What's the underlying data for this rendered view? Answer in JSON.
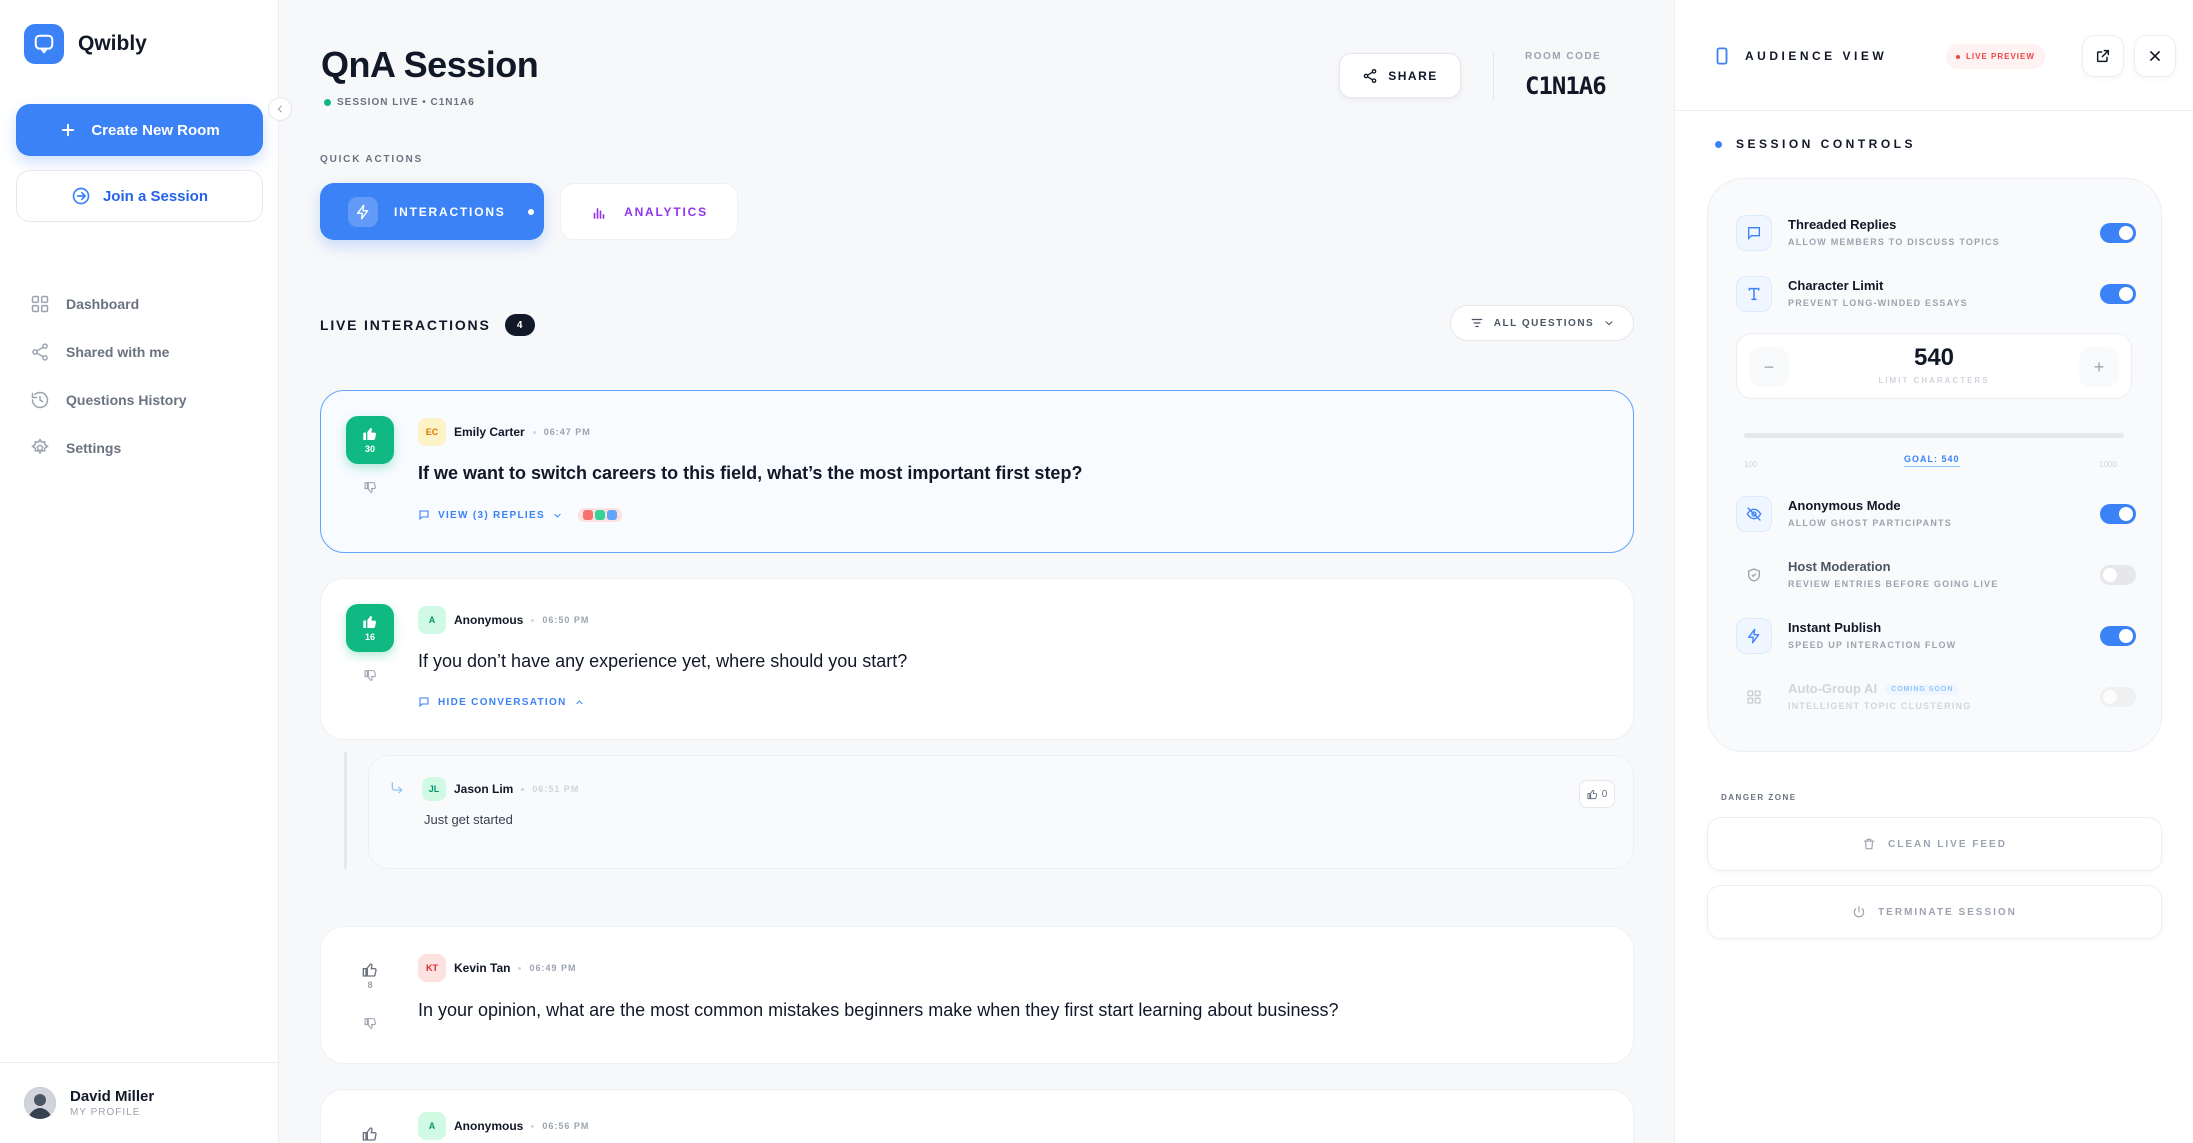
{
  "app": {
    "name": "Qwibly"
  },
  "sidebar": {
    "create_label": "Create New Room",
    "join_label": "Join a Session",
    "nav": [
      {
        "label": "Dashboard",
        "icon": "grid-icon"
      },
      {
        "label": "Shared with me",
        "icon": "share-icon"
      },
      {
        "label": "Questions History",
        "icon": "history-icon"
      },
      {
        "label": "Settings",
        "icon": "gear-icon"
      }
    ],
    "profile": {
      "name": "David Miller",
      "sub": "MY PROFILE"
    }
  },
  "header": {
    "title": "QnA Session",
    "status": "SESSION LIVE • C1N1A6",
    "share_label": "SHARE",
    "room_code_label": "ROOM CODE",
    "room_code": "C1N1A6"
  },
  "quick_actions": {
    "label": "QUICK ACTIONS",
    "interactions": "INTERACTIONS",
    "analytics": "ANALYTICS"
  },
  "live": {
    "label": "LIVE INTERACTIONS",
    "count": "4",
    "filter": "ALL QUESTIONS"
  },
  "questions": [
    {
      "initials": "EC",
      "author": "Emily Carter",
      "time": "06:47 PM",
      "votes": "30",
      "text": "If we want to switch careers to this field, what’s the most important first step?",
      "link": "VIEW (3) REPLIES"
    },
    {
      "initials": "A",
      "author": "Anonymous",
      "time": "06:50 PM",
      "votes": "16",
      "text": "If you don’t have any experience yet, where should you start?",
      "link": "HIDE CONVERSATION"
    },
    {
      "initials": "KT",
      "author": "Kevin Tan",
      "time": "06:49 PM",
      "votes": "8",
      "text": "In your opinion, what are the most common mistakes beginners make when they first start learning about business?"
    },
    {
      "initials": "A",
      "author": "Anonymous",
      "time": "06:56 PM"
    }
  ],
  "reply": {
    "initials": "JL",
    "author": "Jason Lim",
    "time": "06:51 PM",
    "text": "Just get started",
    "likes": "0"
  },
  "panel": {
    "title": "AUDIENCE VIEW",
    "live_badge": "LIVE PREVIEW",
    "controls_title": "SESSION CONTROLS",
    "controls": [
      {
        "name": "Threaded Replies",
        "desc": "ALLOW MEMBERS TO DISCUSS TOPICS",
        "on": true
      },
      {
        "name": "Character Limit",
        "desc": "PREVENT LONG-WINDED ESSAYS",
        "on": true
      },
      {
        "name": "Anonymous Mode",
        "desc": "ALLOW GHOST PARTICIPANTS",
        "on": true
      },
      {
        "name": "Host Moderation",
        "desc": "REVIEW ENTRIES BEFORE GOING LIVE",
        "on": false
      },
      {
        "name": "Instant Publish",
        "desc": "SPEED UP INTERACTION FLOW",
        "on": true
      },
      {
        "name": "Auto-Group AI",
        "desc": "INTELLIGENT TOPIC CLUSTERING",
        "on": false,
        "badge": "COMING SOON"
      }
    ],
    "limit": {
      "value": "540",
      "label": "LIMIT CHARACTERS",
      "min": "100",
      "max": "1000",
      "goal": "GOAL: 540"
    },
    "danger_label": "DANGER ZONE",
    "clean_label": "CLEAN LIVE FEED",
    "terminate_label": "TERMINATE SESSION"
  },
  "colors": {
    "accent": "#3b82f6",
    "success": "#10b981",
    "danger": "#ef4444",
    "analytics": "#9333ea"
  }
}
